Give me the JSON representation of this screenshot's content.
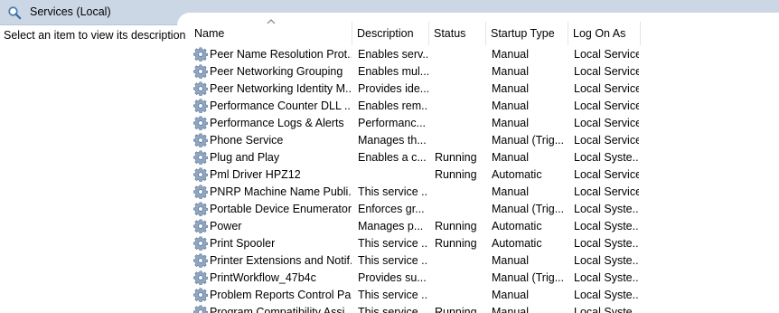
{
  "header": {
    "title": "Services (Local)",
    "icon": "search-icon"
  },
  "left_pane": {
    "description_prompt": "Select an item to view its description."
  },
  "columns": {
    "name": "Name",
    "description": "Description",
    "status": "Status",
    "startup_type": "Startup Type",
    "log_on_as": "Log On As"
  },
  "sort": {
    "column": "Name",
    "direction": "ascending",
    "icon": "sort-ascending-icon"
  },
  "row_icon": "gear-icon",
  "services": [
    {
      "name": "Peer Name Resolution Prot...",
      "description": "Enables serv...",
      "status": "",
      "startup_type": "Manual",
      "log_on_as": "Local Service"
    },
    {
      "name": "Peer Networking Grouping",
      "description": "Enables mul...",
      "status": "",
      "startup_type": "Manual",
      "log_on_as": "Local Service"
    },
    {
      "name": "Peer Networking Identity M...",
      "description": "Provides ide...",
      "status": "",
      "startup_type": "Manual",
      "log_on_as": "Local Service"
    },
    {
      "name": "Performance Counter DLL ...",
      "description": "Enables rem...",
      "status": "",
      "startup_type": "Manual",
      "log_on_as": "Local Service"
    },
    {
      "name": "Performance Logs & Alerts",
      "description": "Performanc...",
      "status": "",
      "startup_type": "Manual",
      "log_on_as": "Local Service"
    },
    {
      "name": "Phone Service",
      "description": "Manages th...",
      "status": "",
      "startup_type": "Manual (Trig...",
      "log_on_as": "Local Service"
    },
    {
      "name": "Plug and Play",
      "description": "Enables a c...",
      "status": "Running",
      "startup_type": "Manual",
      "log_on_as": "Local Syste..."
    },
    {
      "name": "Pml Driver HPZ12",
      "description": "",
      "status": "Running",
      "startup_type": "Automatic",
      "log_on_as": "Local Service"
    },
    {
      "name": "PNRP Machine Name Publi...",
      "description": "This service ...",
      "status": "",
      "startup_type": "Manual",
      "log_on_as": "Local Service"
    },
    {
      "name": "Portable Device Enumerator...",
      "description": "Enforces gr...",
      "status": "",
      "startup_type": "Manual (Trig...",
      "log_on_as": "Local Syste..."
    },
    {
      "name": "Power",
      "description": "Manages p...",
      "status": "Running",
      "startup_type": "Automatic",
      "log_on_as": "Local Syste..."
    },
    {
      "name": "Print Spooler",
      "description": "This service ...",
      "status": "Running",
      "startup_type": "Automatic",
      "log_on_as": "Local Syste..."
    },
    {
      "name": "Printer Extensions and Notif...",
      "description": "This service ...",
      "status": "",
      "startup_type": "Manual",
      "log_on_as": "Local Syste..."
    },
    {
      "name": "PrintWorkflow_47b4c",
      "description": "Provides su...",
      "status": "",
      "startup_type": "Manual (Trig...",
      "log_on_as": "Local Syste..."
    },
    {
      "name": "Problem Reports Control Pa...",
      "description": "This service ...",
      "status": "",
      "startup_type": "Manual",
      "log_on_as": "Local Syste..."
    },
    {
      "name": "Program Compatibility Assi...",
      "description": "This service ...",
      "status": "Running",
      "startup_type": "Manual",
      "log_on_as": "Local Syste..."
    }
  ],
  "colors": {
    "titlebar": "#ccd7e6",
    "header_divider": "#e5e5e5",
    "gear": "#6c87a6"
  }
}
